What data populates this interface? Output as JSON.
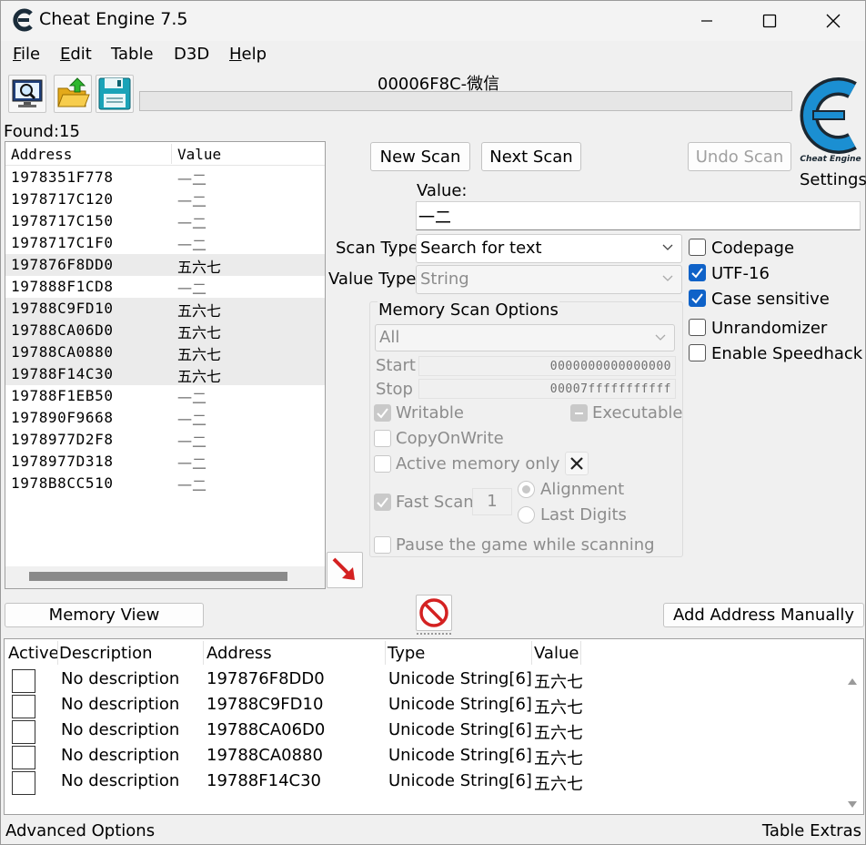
{
  "window": {
    "title": "Cheat Engine 7.5"
  },
  "menu": {
    "file": "ile",
    "file_key": "F",
    "edit": "dit",
    "edit_key": "E",
    "table": "Table",
    "d3d": "D3D",
    "help": "elp",
    "help_key": "H"
  },
  "toolbar": {
    "open_process_icon": "monitor-magnifier-icon",
    "open_file_icon": "folder-open-icon",
    "save_icon": "floppy-disk-icon",
    "process_label": "00006F8C-微信",
    "progress": 0
  },
  "scan": {
    "found_label": "Found:15",
    "columns": [
      "Address",
      "Value"
    ],
    "results": [
      {
        "address": "1978351F778",
        "value": "一二",
        "highlight": false
      },
      {
        "address": "1978717C120",
        "value": "一二",
        "highlight": false
      },
      {
        "address": "1978717C150",
        "value": "一二",
        "highlight": false
      },
      {
        "address": "1978717C1F0",
        "value": "一二",
        "highlight": false
      },
      {
        "address": "197876F8DD0",
        "value": "五六七",
        "highlight": true
      },
      {
        "address": "197888F1CD8",
        "value": "一二",
        "highlight": false
      },
      {
        "address": "19788C9FD10",
        "value": "五六七",
        "highlight": true
      },
      {
        "address": "19788CA06D0",
        "value": "五六七",
        "highlight": true
      },
      {
        "address": "19788CA0880",
        "value": "五六七",
        "highlight": true
      },
      {
        "address": "19788F14C30",
        "value": "五六七",
        "highlight": true
      },
      {
        "address": "19788F1EB50",
        "value": "一二",
        "highlight": false
      },
      {
        "address": "197890F9668",
        "value": "一二",
        "highlight": false
      },
      {
        "address": "1978977D2F8",
        "value": "一二",
        "highlight": false
      },
      {
        "address": "1978977D318",
        "value": "一二",
        "highlight": false
      },
      {
        "address": "1978B8CC510",
        "value": "一二",
        "highlight": false
      }
    ],
    "new_scan": "New Scan",
    "next_scan": "Next Scan",
    "undo_scan": "Undo Scan",
    "settings": "Settings",
    "value_label": "Value:",
    "value_input": "一二",
    "scan_type_label": "Scan Type",
    "scan_type_value": "Search for text",
    "value_type_label": "Value Type",
    "value_type_value": "String",
    "codepage": "Codepage",
    "utf16": "UTF-16",
    "case_sensitive": "Case sensitive",
    "unrandomizer": "Unrandomizer",
    "speedhack": "Enable Speedhack"
  },
  "memory_options": {
    "title": "Memory Scan Options",
    "region": "All",
    "start_label": "Start",
    "start_value": "0000000000000000",
    "stop_label": "Stop",
    "stop_value": "00007fffffffffff",
    "writable": "Writable",
    "executable": "Executable",
    "copy_on_write": "CopyOnWrite",
    "active_memory": "Active memory only",
    "fast_scan": "Fast Scan",
    "fast_scan_value": "1",
    "alignment": "Alignment",
    "last_digits": "Last Digits",
    "pause_game": "Pause the game while scanning"
  },
  "bottom": {
    "memory_view": "Memory View",
    "add_address": "Add Address Manually",
    "advanced_options": "Advanced Options",
    "table_extras": "Table Extras"
  },
  "address_list": {
    "columns": [
      "Active",
      "Description",
      "Address",
      "Type",
      "Value"
    ],
    "rows": [
      {
        "description": "No description",
        "address": "197876F8DD0",
        "type": "Unicode String[6]",
        "value": "五六七"
      },
      {
        "description": "No description",
        "address": "19788C9FD10",
        "type": "Unicode String[6]",
        "value": "五六七"
      },
      {
        "description": "No description",
        "address": "19788CA06D0",
        "type": "Unicode String[6]",
        "value": "五六七"
      },
      {
        "description": "No description",
        "address": "19788CA0880",
        "type": "Unicode String[6]",
        "value": "五六七"
      },
      {
        "description": "No description",
        "address": "19788F14C30",
        "type": "Unicode String[6]",
        "value": "五六七"
      }
    ]
  },
  "colors": {
    "accent": "#0f62c8",
    "logo": "#1b8fd2",
    "stop_red": "#d42121"
  }
}
